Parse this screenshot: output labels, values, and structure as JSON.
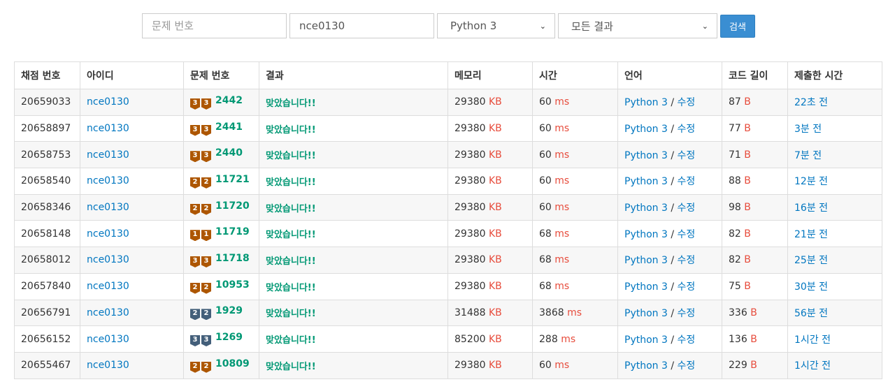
{
  "search": {
    "problem_placeholder": "문제 번호",
    "user_value": "nce0130",
    "language_value": "Python 3",
    "result_value": "모든 결과",
    "button_label": "검색"
  },
  "table": {
    "headers": [
      "채점 번호",
      "아이디",
      "문제 번호",
      "결과",
      "메모리",
      "시간",
      "언어",
      "코드 길이",
      "제출한 시간"
    ],
    "rows": [
      {
        "id": "20659033",
        "user": "nce0130",
        "tier_level": "3",
        "tier_color": "bronze",
        "problem": "2442",
        "result": "맞았습니다!!",
        "memory": "29380",
        "memory_unit": "KB",
        "time": "60",
        "time_unit": "ms",
        "lang": "Python 3",
        "edit": "수정",
        "code_len": "87",
        "len_unit": "B",
        "submitted": "22초 전"
      },
      {
        "id": "20658897",
        "user": "nce0130",
        "tier_level": "3",
        "tier_color": "bronze",
        "problem": "2441",
        "result": "맞았습니다!!",
        "memory": "29380",
        "memory_unit": "KB",
        "time": "60",
        "time_unit": "ms",
        "lang": "Python 3",
        "edit": "수정",
        "code_len": "77",
        "len_unit": "B",
        "submitted": "3분 전"
      },
      {
        "id": "20658753",
        "user": "nce0130",
        "tier_level": "3",
        "tier_color": "bronze",
        "problem": "2440",
        "result": "맞았습니다!!",
        "memory": "29380",
        "memory_unit": "KB",
        "time": "60",
        "time_unit": "ms",
        "lang": "Python 3",
        "edit": "수정",
        "code_len": "71",
        "len_unit": "B",
        "submitted": "7분 전"
      },
      {
        "id": "20658540",
        "user": "nce0130",
        "tier_level": "2",
        "tier_color": "bronze",
        "problem": "11721",
        "result": "맞았습니다!!",
        "memory": "29380",
        "memory_unit": "KB",
        "time": "60",
        "time_unit": "ms",
        "lang": "Python 3",
        "edit": "수정",
        "code_len": "88",
        "len_unit": "B",
        "submitted": "12분 전"
      },
      {
        "id": "20658346",
        "user": "nce0130",
        "tier_level": "2",
        "tier_color": "bronze",
        "problem": "11720",
        "result": "맞았습니다!!",
        "memory": "29380",
        "memory_unit": "KB",
        "time": "60",
        "time_unit": "ms",
        "lang": "Python 3",
        "edit": "수정",
        "code_len": "98",
        "len_unit": "B",
        "submitted": "16분 전"
      },
      {
        "id": "20658148",
        "user": "nce0130",
        "tier_level": "1",
        "tier_color": "bronze",
        "problem": "11719",
        "result": "맞았습니다!!",
        "memory": "29380",
        "memory_unit": "KB",
        "time": "68",
        "time_unit": "ms",
        "lang": "Python 3",
        "edit": "수정",
        "code_len": "82",
        "len_unit": "B",
        "submitted": "21분 전"
      },
      {
        "id": "20658012",
        "user": "nce0130",
        "tier_level": "3",
        "tier_color": "bronze",
        "problem": "11718",
        "result": "맞았습니다!!",
        "memory": "29380",
        "memory_unit": "KB",
        "time": "68",
        "time_unit": "ms",
        "lang": "Python 3",
        "edit": "수정",
        "code_len": "82",
        "len_unit": "B",
        "submitted": "25분 전"
      },
      {
        "id": "20657840",
        "user": "nce0130",
        "tier_level": "2",
        "tier_color": "bronze",
        "problem": "10953",
        "result": "맞았습니다!!",
        "memory": "29380",
        "memory_unit": "KB",
        "time": "68",
        "time_unit": "ms",
        "lang": "Python 3",
        "edit": "수정",
        "code_len": "75",
        "len_unit": "B",
        "submitted": "30분 전"
      },
      {
        "id": "20656791",
        "user": "nce0130",
        "tier_level": "2",
        "tier_color": "silver",
        "problem": "1929",
        "result": "맞았습니다!!",
        "memory": "31488",
        "memory_unit": "KB",
        "time": "3868",
        "time_unit": "ms",
        "lang": "Python 3",
        "edit": "수정",
        "code_len": "336",
        "len_unit": "B",
        "submitted": "56분 전"
      },
      {
        "id": "20656152",
        "user": "nce0130",
        "tier_level": "3",
        "tier_color": "silver",
        "problem": "1269",
        "result": "맞았습니다!!",
        "memory": "85200",
        "memory_unit": "KB",
        "time": "288",
        "time_unit": "ms",
        "lang": "Python 3",
        "edit": "수정",
        "code_len": "136",
        "len_unit": "B",
        "submitted": "1시간 전"
      },
      {
        "id": "20655467",
        "user": "nce0130",
        "tier_level": "2",
        "tier_color": "bronze",
        "problem": "10809",
        "result": "맞았습니다!!",
        "memory": "29380",
        "memory_unit": "KB",
        "time": "60",
        "time_unit": "ms",
        "lang": "Python 3",
        "edit": "수정",
        "code_len": "229",
        "len_unit": "B",
        "submitted": "1시간 전"
      }
    ]
  }
}
